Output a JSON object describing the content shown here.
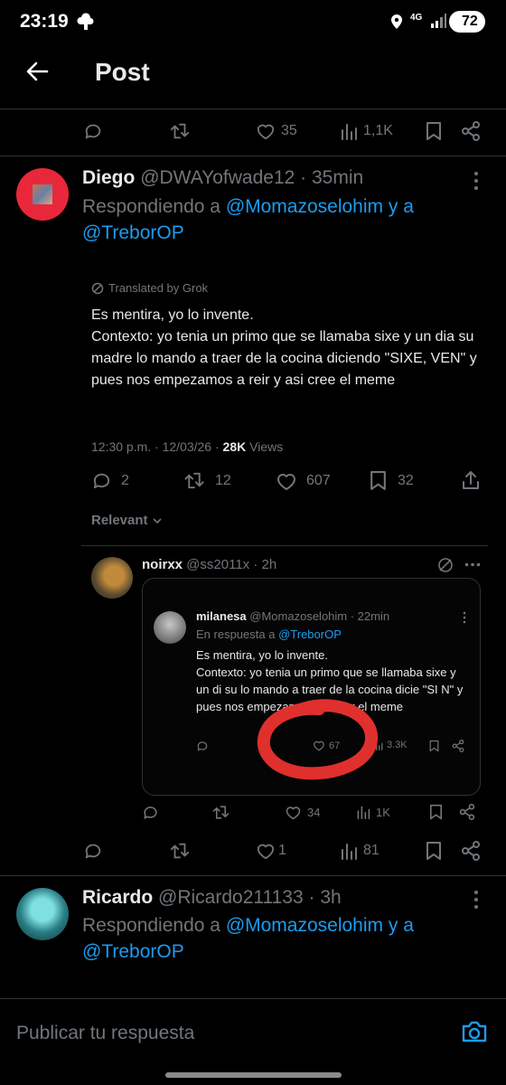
{
  "status_bar": {
    "time": "23:19",
    "network": "4G",
    "battery": "72"
  },
  "header": {
    "title": "Post"
  },
  "top_actions": {
    "likes": "35",
    "views": "1,1K"
  },
  "reply1": {
    "name": "Diego",
    "handle": "@DWAYofwade12",
    "time": "· 35min",
    "replying_prefix": "Respondiendo a",
    "replying_user1": "@Momazoselohim",
    "replying_and": "y a",
    "replying_user2": "@TreborOP"
  },
  "translated_label": "Translated by Grok",
  "main_post": {
    "line1": "Es mentira, yo lo invente.",
    "line2": "Contexto: yo tenia un primo que se llamaba sixe y un dia su madre lo mando a traer de la cocina diciendo \"SIXE, VEN\" y pues nos empezamos a reir y asi cree el meme",
    "timestamp": "12:30 p.m. · 12/03/26 ·",
    "views_count": "28K",
    "views_label": "Views",
    "replies": "2",
    "reposts": "12",
    "likes": "607",
    "bookmarks": "32"
  },
  "relevant_label": "Relevant",
  "nested_reply": {
    "name": "noirxx",
    "handle": "@ss2011x · 2h",
    "quote": {
      "name": "milanesa",
      "handle": "@Momazoselohim · 22min",
      "reply_prefix": "En respuesta a",
      "reply_user": "@TreborOP",
      "line1": "Es mentira, yo lo invente.",
      "line2": "Contexto: yo tenia un primo que se llamaba sixe y un di  su    lo mando a traer de la cocina dicie    \"SI    N\" y pues nos empezamos:      y asi cr    el meme",
      "likes": "67",
      "views": "3.3K"
    },
    "likes": "34",
    "views": "1K"
  },
  "reply1_actions": {
    "likes": "1",
    "views": "81"
  },
  "reply2": {
    "name": "Ricardo",
    "handle": "@Ricardo211133",
    "time": "· 3h",
    "replying_prefix": "Respondiendo a",
    "replying_user1": "@Momazoselohim",
    "replying_and": "y a",
    "replying_user2": "@TreborOP"
  },
  "composer": {
    "placeholder": "Publicar tu respuesta"
  },
  "colors": {
    "accent": "#1d9bf0",
    "annotation": "#e0302e"
  }
}
